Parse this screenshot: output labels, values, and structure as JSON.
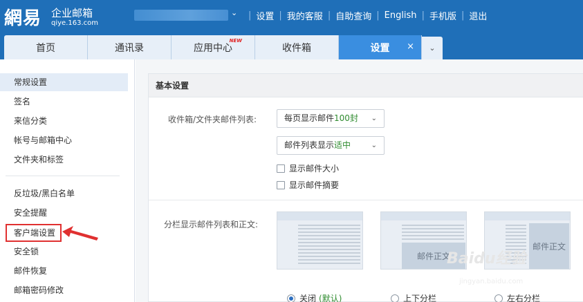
{
  "brand": {
    "logo": "網易",
    "product": "企业邮箱",
    "domain": "qiye.163.com"
  },
  "header": {
    "caret_icon": "chevron-down-icon",
    "links": [
      "设置",
      "我的客服",
      "自助查询",
      "English",
      "手机版",
      "退出"
    ]
  },
  "tabs": [
    {
      "label": "首页",
      "badge": ""
    },
    {
      "label": "通讯录",
      "badge": ""
    },
    {
      "label": "应用中心",
      "badge": "NEW"
    },
    {
      "label": "收件箱",
      "badge": ""
    },
    {
      "label": "设置",
      "badge": "",
      "close": "×"
    }
  ],
  "tab_more_icon": "chevron-down-icon",
  "sidebar": {
    "items": [
      {
        "label": "常规设置"
      },
      {
        "label": "签名"
      },
      {
        "label": "来信分类"
      },
      {
        "label": "帐号与邮箱中心"
      },
      {
        "label": "文件夹和标签"
      },
      {
        "label": "反垃圾/黑白名单"
      },
      {
        "label": "安全提醒"
      },
      {
        "label": "客户端设置"
      },
      {
        "label": "安全锁"
      },
      {
        "label": "邮件恢复"
      },
      {
        "label": "邮箱密码修改"
      }
    ],
    "highlight_color": "#e03030"
  },
  "main": {
    "section_title": "基本设置",
    "list_label": "收件箱/文件夹邮件列表:",
    "page_size_select": {
      "prefix": "每页显示邮件",
      "value": "100封"
    },
    "density_select": {
      "prefix": "邮件列表显示",
      "value": "适中"
    },
    "checkbox_size": "显示邮件大小",
    "checkbox_summary": "显示邮件摘要",
    "split_label": "分栏显示邮件列表和正文:",
    "thumb_body_text": "邮件正文",
    "radios": [
      {
        "label": "关闭",
        "note": "(默认)",
        "checked": true
      },
      {
        "label": "上下分栏",
        "note": "",
        "checked": false
      },
      {
        "label": "左右分栏",
        "note": "",
        "checked": false
      }
    ]
  },
  "watermark": {
    "text": "Baidu经验",
    "sub": "jingyan.baidu.com"
  },
  "colors": {
    "header_bg": "#1f6fb8",
    "tab_active": "#3a8ee0",
    "accent_green": "#2e8b2e"
  }
}
